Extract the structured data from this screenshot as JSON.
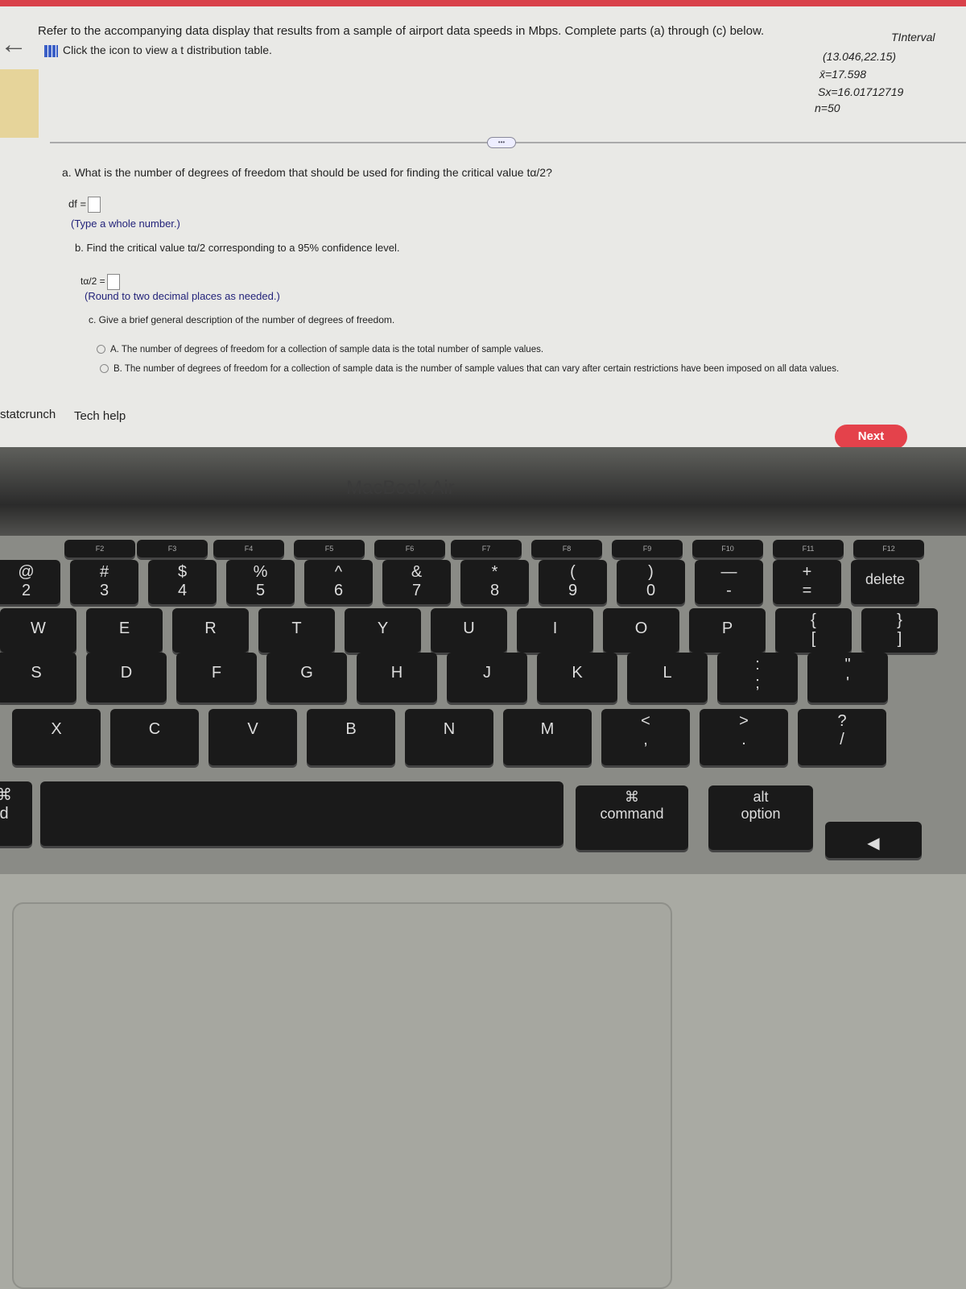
{
  "question": {
    "intro": "Refer to the accompanying data display that results from a sample of airport data speeds in Mbps. Complete parts (a) through (c) below.",
    "table_link": "Click the icon to view a t distribution table.",
    "display": {
      "title": "TInterval",
      "interval": "(13.046,22.15)",
      "mean": "x̄=17.598",
      "sx": "Sx=16.01712719",
      "n": "n=50"
    },
    "part_a": {
      "prompt": "a. What is the number of degrees of freedom that should be used for finding the critical value tα/2?",
      "label": "df =",
      "value": "",
      "hint": "(Type a whole number.)"
    },
    "part_b": {
      "prompt": "b. Find the critical value tα/2 corresponding to a 95% confidence level.",
      "label": "tα/2 =",
      "value": "",
      "hint": "(Round to two decimal places as needed.)"
    },
    "part_c": {
      "prompt": "c. Give a brief general description of the number of degrees of freedom.",
      "options": [
        {
          "letter": "A.",
          "text": "The number of degrees of freedom for a collection of sample data is the total number of sample values."
        },
        {
          "letter": "B.",
          "text": "The number of degrees of freedom for a collection of sample data is the number of sample values that can vary after certain restrictions have been imposed on all data values."
        }
      ]
    }
  },
  "footer": {
    "statcrunch": "statcrunch",
    "tech_help": "Tech help",
    "next": "Next"
  },
  "colors": {
    "accent": "#e4424b",
    "top_bar": "#d9414a"
  },
  "laptop": {
    "brand": "MacBook Air"
  },
  "keyboard": {
    "fn_row": [
      "F2",
      "F3",
      "F4",
      "F5",
      "F6",
      "F7",
      "F8",
      "F9",
      "F10",
      "F11",
      "F12"
    ],
    "keys": [
      [
        "@",
        "2"
      ],
      [
        "#",
        "3"
      ],
      [
        "$",
        "4"
      ],
      [
        "%",
        "5"
      ],
      [
        "^",
        "6"
      ],
      [
        "&",
        "7"
      ],
      [
        "*",
        "8"
      ],
      [
        "(",
        "9"
      ],
      [
        ")",
        "0"
      ],
      [
        "—",
        "-"
      ],
      [
        "+",
        "="
      ],
      [
        "",
        "delete"
      ],
      [
        "",
        "W"
      ],
      [
        "",
        "E"
      ],
      [
        "",
        "R"
      ],
      [
        "",
        "T"
      ],
      [
        "",
        "Y"
      ],
      [
        "",
        "U"
      ],
      [
        "",
        "I"
      ],
      [
        "",
        "O"
      ],
      [
        "",
        "P"
      ],
      [
        "{",
        "["
      ],
      [
        "}",
        "]"
      ],
      [
        "",
        "S"
      ],
      [
        "",
        "D"
      ],
      [
        "",
        "F"
      ],
      [
        "",
        "G"
      ],
      [
        "",
        "H"
      ],
      [
        "",
        "J"
      ],
      [
        "",
        "K"
      ],
      [
        "",
        "L"
      ],
      [
        ":",
        ";"
      ],
      [
        "\"",
        "'"
      ],
      [
        "",
        "X"
      ],
      [
        "",
        "C"
      ],
      [
        "",
        "V"
      ],
      [
        "",
        "B"
      ],
      [
        "",
        "N"
      ],
      [
        "",
        "M"
      ],
      [
        "<",
        ","
      ],
      [
        ">",
        "."
      ],
      [
        "?",
        "/"
      ],
      [
        "⌘",
        "d"
      ],
      [
        "",
        ""
      ],
      [
        "⌘",
        "command"
      ],
      [
        "alt",
        "option"
      ],
      [
        "",
        "◀"
      ]
    ]
  }
}
